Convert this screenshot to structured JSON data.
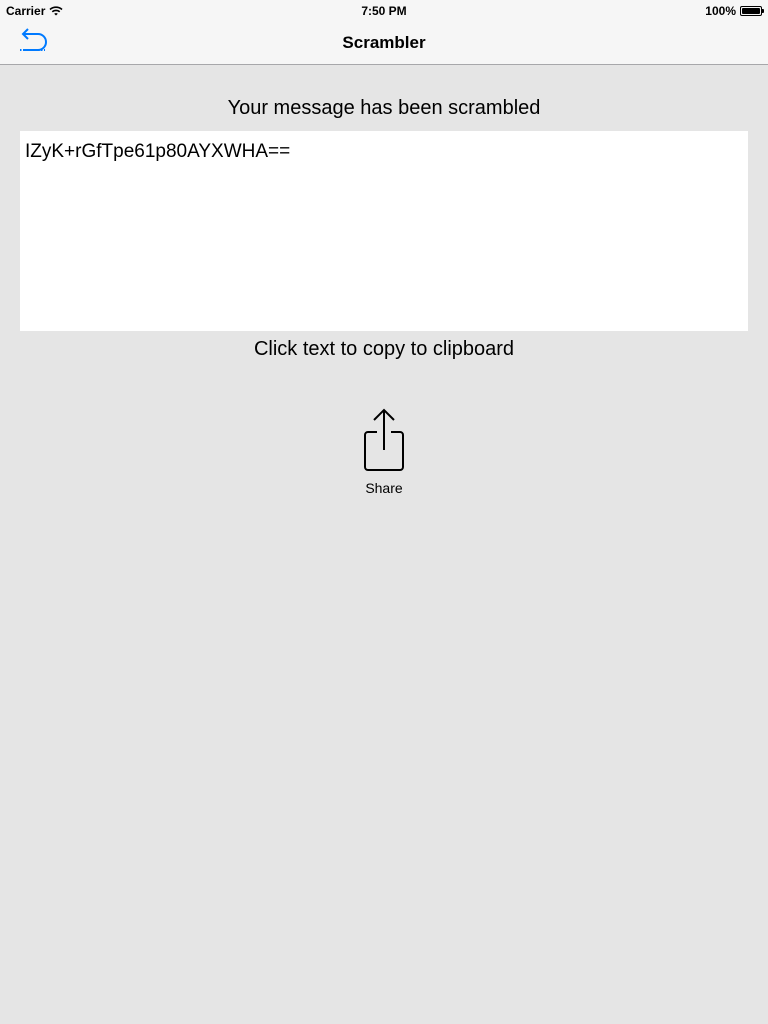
{
  "status_bar": {
    "carrier": "Carrier",
    "time": "7:50 PM",
    "battery": "100%"
  },
  "nav": {
    "title": "Scrambler",
    "back_icon": "undo-arrow-icon",
    "accent_color": "#007aff"
  },
  "main": {
    "heading": "Your message has been scrambled",
    "scrambled_text": "IZyK+rGfTpe61p80AYXWHA==",
    "hint": "Click text to copy to clipboard",
    "share_label": "Share",
    "share_icon": "share-icon"
  }
}
